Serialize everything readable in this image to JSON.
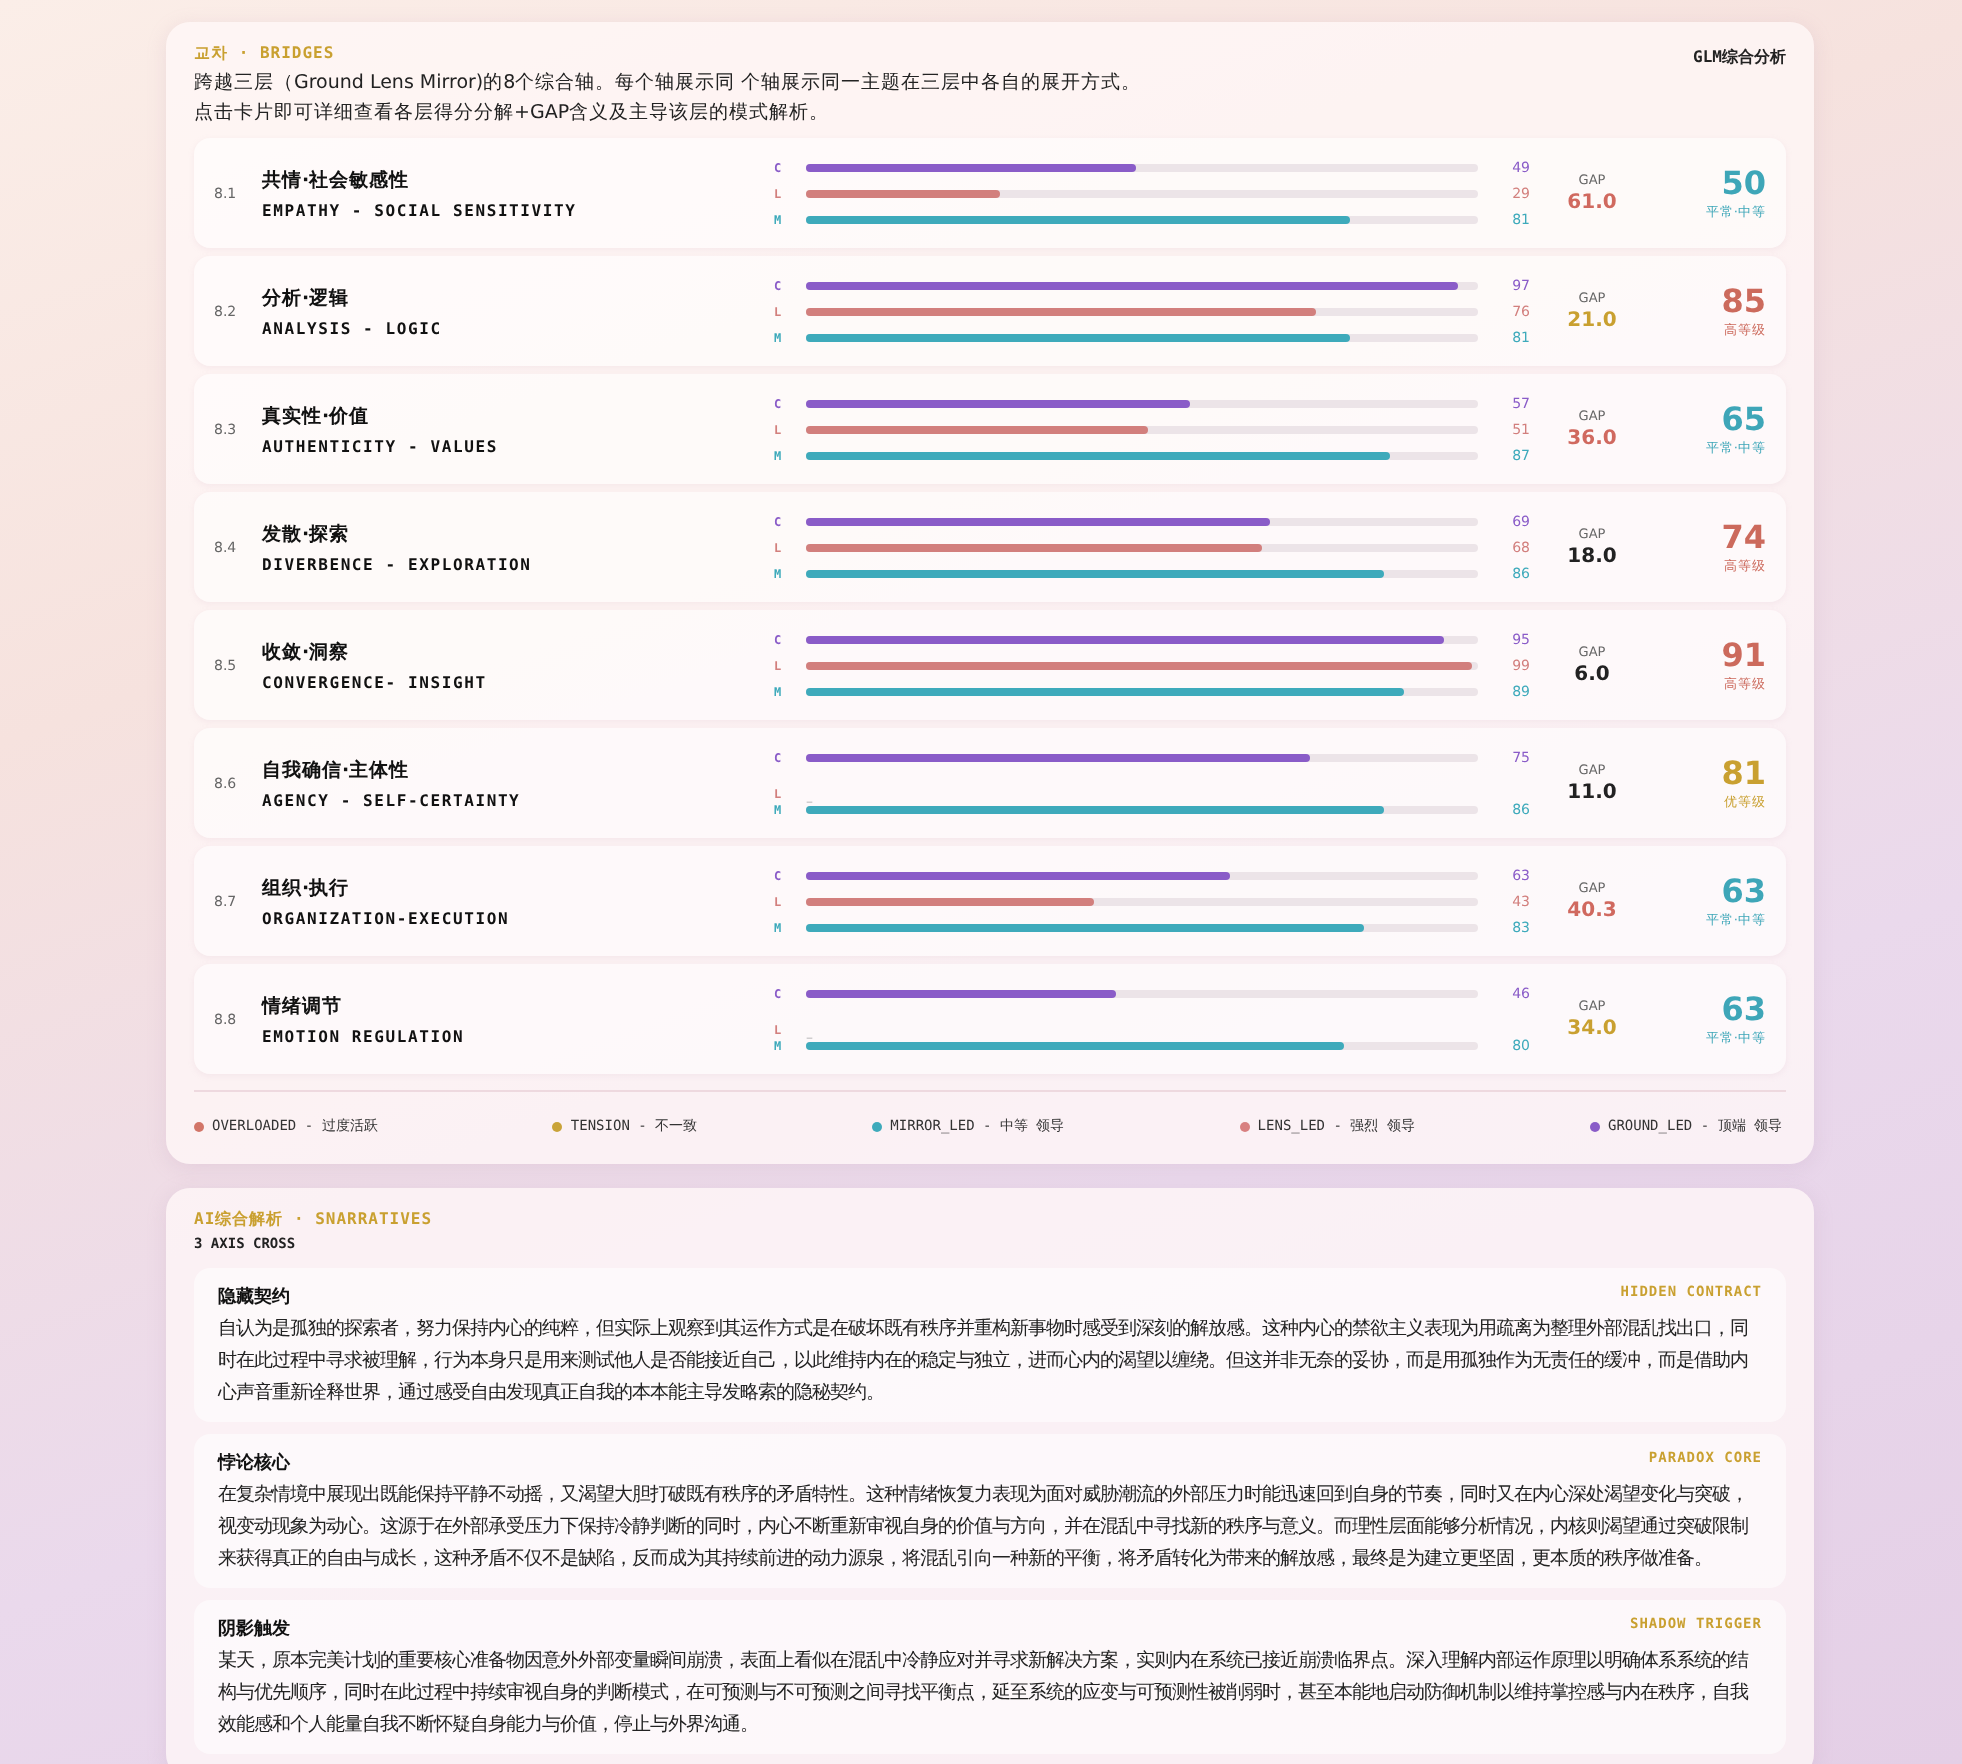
{
  "bridges": {
    "tag": "교차 · BRIDGES",
    "badge": "GLM综合分析",
    "description": [
      "跨越三层（Ground Lens Mirror)的8个综合轴。每个轴展示同 个轴展示同一主题在三层中各自的展开方式。",
      "点击卡片即可详细查看各层得分分解+GAP含义及主导该层的模式解析。"
    ],
    "axes": [
      {
        "number": "8.1",
        "title": "共情·社会敏感性",
        "subtitle": "EMPATHY - SOCIAL SENSITIVITY",
        "bars": [
          {
            "channel": "C",
            "level": 0.49,
            "value": "49"
          },
          {
            "channel": "L",
            "level": 0.29,
            "value": "29"
          },
          {
            "channel": "M",
            "level": 0.81,
            "value": "81"
          }
        ],
        "gap_label": "GAP",
        "gap": {
          "value": "61.0",
          "color": "#d0695f"
        },
        "score": {
          "value": "50",
          "grade": "平常·中等",
          "color": "#3ea6b8"
        }
      },
      {
        "number": "8.2",
        "title": "分析·逻辑",
        "subtitle": "ANALYSIS - LOGIC",
        "bars": [
          {
            "channel": "C",
            "level": 0.97,
            "value": "97"
          },
          {
            "channel": "L",
            "level": 0.76,
            "value": "76"
          },
          {
            "channel": "M",
            "level": 0.81,
            "value": "81"
          }
        ],
        "gap_label": "GAP",
        "gap": {
          "value": "21.0",
          "color": "#c9a030"
        },
        "score": {
          "value": "85",
          "grade": "高等级",
          "color": "#cc6a5c"
        }
      },
      {
        "number": "8.3",
        "title": "真实性·价值",
        "subtitle": "AUTHENTICITY - VALUES",
        "bars": [
          {
            "channel": "C",
            "level": 0.57,
            "value": "57"
          },
          {
            "channel": "L",
            "level": 0.51,
            "value": "51"
          },
          {
            "channel": "M",
            "level": 0.87,
            "value": "87"
          }
        ],
        "gap_label": "GAP",
        "gap": {
          "value": "36.0",
          "color": "#d0695f"
        },
        "score": {
          "value": "65",
          "grade": "平常·中等",
          "color": "#3ea6b8"
        }
      },
      {
        "number": "8.4",
        "title": "发散·探索",
        "subtitle": "DIVERBENCE - EXPLORATION",
        "bars": [
          {
            "channel": "C",
            "level": 0.69,
            "value": "69"
          },
          {
            "channel": "L",
            "level": 0.68,
            "value": "68"
          },
          {
            "channel": "M",
            "level": 0.86,
            "value": "86"
          }
        ],
        "gap_label": "GAP",
        "gap": {
          "value": "18.0",
          "color": "#222222"
        },
        "score": {
          "value": "74",
          "grade": "高等级",
          "color": "#cc6a5c"
        }
      },
      {
        "number": "8.5",
        "title": "收敛·洞察",
        "subtitle": "CONVERGENCE- INSIGHT",
        "bars": [
          {
            "channel": "C",
            "level": 0.95,
            "value": "95"
          },
          {
            "channel": "L",
            "level": 0.99,
            "value": "99"
          },
          {
            "channel": "M",
            "level": 0.89,
            "value": "89"
          }
        ],
        "gap_label": "GAP",
        "gap": {
          "value": "6.0",
          "color": "#222222"
        },
        "score": {
          "value": "91",
          "grade": "高等级",
          "color": "#cc6a5c"
        }
      },
      {
        "number": "8.6",
        "title": "自我确信·主体性",
        "subtitle": "AGENCY - SELF-CERTAINTY",
        "bars": [
          {
            "channel": "C",
            "level": 0.75,
            "value": "75"
          },
          {
            "channel": "L",
            "placeholder": "–"
          },
          {
            "channel": "M",
            "level": 0.86,
            "value": "86"
          }
        ],
        "gap_label": "GAP",
        "gap": {
          "value": "11.0",
          "color": "#222222"
        },
        "score": {
          "value": "81",
          "grade": "优等级",
          "color": "#c9a030"
        }
      },
      {
        "number": "8.7",
        "title": "组织·执行",
        "subtitle": "ORGANIZATION-EXECUTION",
        "bars": [
          {
            "channel": "C",
            "level": 0.63,
            "value": "63"
          },
          {
            "channel": "L",
            "level": 0.43,
            "value": "43"
          },
          {
            "channel": "M",
            "level": 0.83,
            "value": "83"
          }
        ],
        "gap_label": "GAP",
        "gap": {
          "value": "40.3",
          "color": "#d0695f"
        },
        "score": {
          "value": "63",
          "grade": "平常·中等",
          "color": "#3ea6b8"
        }
      },
      {
        "number": "8.8",
        "title": "情绪调节",
        "subtitle": "EMOTION REGULATION",
        "bars": [
          {
            "channel": "C",
            "level": 0.46,
            "value": "46"
          },
          {
            "channel": "L",
            "placeholder": "–"
          },
          {
            "channel": "M",
            "level": 0.8,
            "value": "80"
          }
        ],
        "gap_label": "GAP",
        "gap": {
          "value": "34.0",
          "color": "#c9a030"
        },
        "score": {
          "value": "63",
          "grade": "平常·中等",
          "color": "#3ea6b8"
        }
      }
    ],
    "legend": [
      {
        "label": "OVERLOADED - 过度活跃",
        "color": "#d27568"
      },
      {
        "label": "TENSION - 不一致",
        "color": "#c9a338"
      },
      {
        "label": "MIRROR_LED - 中等 领导",
        "color": "#3eaabb"
      },
      {
        "label": "LENS_LED - 强烈 领导",
        "color": "#d88080"
      },
      {
        "label": "GROUND_LED - 顶端 领导",
        "color": "#8a5cc8"
      }
    ]
  },
  "narratives": {
    "tag": "AI综合解析 · SNARRATIVES",
    "subtitle": "3 AXIS CROSS",
    "items": [
      {
        "title": "隐藏契约",
        "tag": "HIDDEN CONTRACT",
        "text": "自认为是孤独的探索者，努力保持内心的纯粹，但实际上观察到其运作方式是在破坏既有秩序并重构新事物时感受到深刻的解放感。这种内心的禁欲主义表现为用疏离为整理外部混乱找出口，同时在此过程中寻求被理解，行为本身只是用来测试他人是否能接近自己，以此维持内在的稳定与独立，进而心内的渴望以缠绕。但这并非无奈的妥协，而是用孤独作为无责任的缓冲，而是借助内心声音重新诠释世界，通过感受自由发现真正自我的本本能主导发略索的隐秘契约。"
      },
      {
        "title": "悖论核心",
        "tag": "PARADOX CORE",
        "text": "在复杂情境中展现出既能保持平静不动摇，又渴望大胆打破既有秩序的矛盾特性。这种情绪恢复力表现为面对威胁潮流的外部压力时能迅速回到自身的节奏，同时又在内心深处渴望变化与突破，视变动现象为动心。这源于在外部承受压力下保持冷静判断的同时，内心不断重新审视自身的价值与方向，并在混乱中寻找新的秩序与意义。而理性层面能够分析情况，内核则渴望通过突破限制来获得真正的自由与成长，这种矛盾不仅不是缺陷，反而成为其持续前进的动力源泉，将混乱引向一种新的平衡，将矛盾转化为带来的解放感，最终是为建立更坚固，更本质的秩序做准备。"
      },
      {
        "title": "阴影触发",
        "tag": "SHADOW TRIGGER",
        "text": "某天，原本完美计划的重要核心准备物因意外外部变量瞬间崩溃，表面上看似在混乱中冷静应对并寻求新解决方案，实则内在系统已接近崩溃临界点。深入理解内部运作原理以明确体系系统的结构与优先顺序，同时在此过程中持续审视自身的判断模式，在可预测与不可预测之间寻找平衡点，延至系统的应变与可预测性被削弱时，甚至本能地启动防御机制以维持掌控感与内在秩序，自我效能感和个人能量自我不断怀疑自身能力与价值，停止与外界沟通。"
      }
    ]
  }
}
